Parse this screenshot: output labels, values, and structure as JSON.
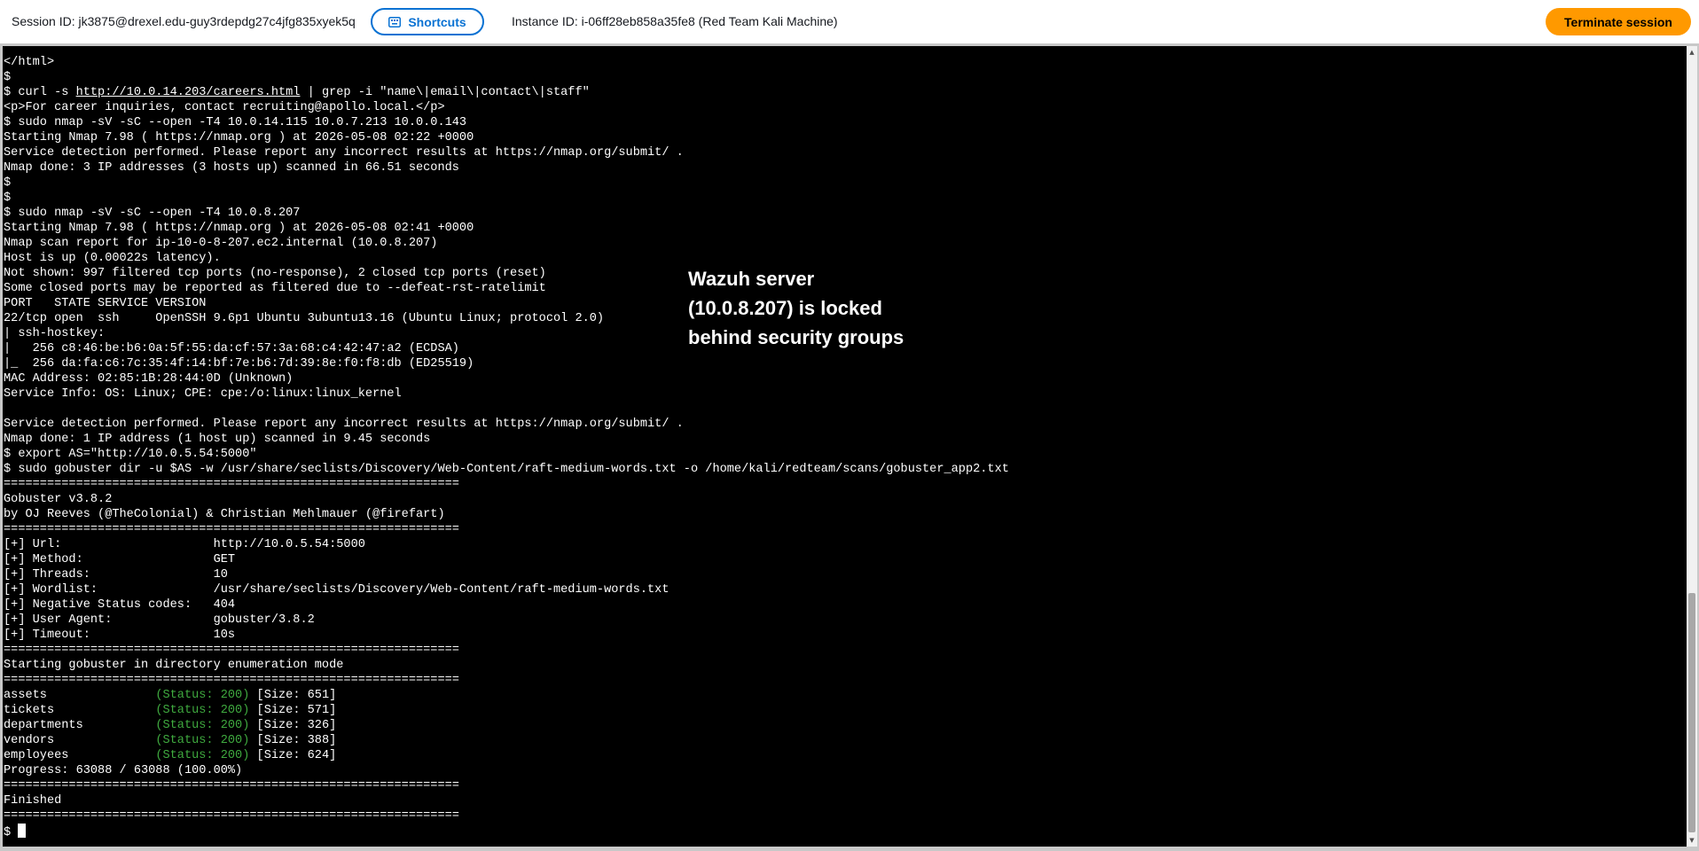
{
  "header": {
    "session_id": "Session ID: jk3875@drexel.edu-guy3rdepdg27c4jfg835xyek5q",
    "shortcuts_label": "Shortcuts",
    "instance_id": "Instance ID: i-06ff28eb858a35fe8 (Red Team Kali Machine)",
    "terminate_label": "Terminate session",
    "colors": {
      "shortcuts_border": "#0972d3",
      "terminate_bg": "#ff9900"
    }
  },
  "terminal": {
    "lines": [
      "</html>",
      "$",
      "$ curl -s http://10.0.14.203/careers.html | grep -i \"name\\|email\\|contact\\|staff\"",
      "<p>For career inquiries, contact recruiting@apollo.local.</p>",
      "$ sudo nmap -sV -sC --open -T4 10.0.14.115 10.0.7.213 10.0.0.143",
      "Starting Nmap 7.98 ( https://nmap.org ) at 2026-05-08 02:22 +0000",
      "Service detection performed. Please report any incorrect results at https://nmap.org/submit/ .",
      "Nmap done: 3 IP addresses (3 hosts up) scanned in 66.51 seconds",
      "$",
      "$",
      "$ sudo nmap -sV -sC --open -T4 10.0.8.207",
      "Starting Nmap 7.98 ( https://nmap.org ) at 2026-05-08 02:41 +0000",
      "Nmap scan report for ip-10-0-8-207.ec2.internal (10.0.8.207)",
      "Host is up (0.00022s latency).",
      "Not shown: 997 filtered tcp ports (no-response), 2 closed tcp ports (reset)",
      "Some closed ports may be reported as filtered due to --defeat-rst-ratelimit",
      "PORT   STATE SERVICE VERSION",
      "22/tcp open  ssh     OpenSSH 9.6p1 Ubuntu 3ubuntu13.16 (Ubuntu Linux; protocol 2.0)",
      "| ssh-hostkey:",
      "|   256 c8:46:be:b6:0a:5f:55:da:cf:57:3a:68:c4:42:47:a2 (ECDSA)",
      "|_  256 da:fa:c6:7c:35:4f:14:bf:7e:b6:7d:39:8e:f0:f8:db (ED25519)",
      "MAC Address: 02:85:1B:28:44:0D (Unknown)",
      "Service Info: OS: Linux; CPE: cpe:/o:linux:linux_kernel",
      "",
      "Service detection performed. Please report any incorrect results at https://nmap.org/submit/ .",
      "Nmap done: 1 IP address (1 host up) scanned in 9.45 seconds",
      "$ export AS=\"http://10.0.5.54:5000\"",
      "$ sudo gobuster dir -u $AS -w /usr/share/seclists/Discovery/Web-Content/raft-medium-words.txt -o /home/kali/redteam/scans/gobuster_app2.txt",
      "===============================================================",
      "Gobuster v3.8.2",
      "by OJ Reeves (@TheColonial) & Christian Mehlmauer (@firefart)",
      "===============================================================",
      "[+] Url:                     http://10.0.5.54:5000",
      "[+] Method:                  GET",
      "[+] Threads:                 10",
      "[+] Wordlist:                /usr/share/seclists/Discovery/Web-Content/raft-medium-words.txt",
      "[+] Negative Status codes:   404",
      "[+] User Agent:              gobuster/3.8.2",
      "[+] Timeout:                 10s",
      "===============================================================",
      "Starting gobuster in directory enumeration mode",
      "==============================================================="
    ],
    "results": [
      {
        "name": "assets               ",
        "status": "(Status: 200)",
        "size": " [Size: 651]"
      },
      {
        "name": "tickets              ",
        "status": "(Status: 200)",
        "size": " [Size: 571]"
      },
      {
        "name": "departments          ",
        "status": "(Status: 200)",
        "size": " [Size: 326]"
      },
      {
        "name": "vendors              ",
        "status": "(Status: 200)",
        "size": " [Size: 388]"
      },
      {
        "name": "employees            ",
        "status": "(Status: 200)",
        "size": " [Size: 624]"
      }
    ],
    "tail_lines": [
      "Progress: 63088 / 63088 (100.00%)",
      "===============================================================",
      "Finished",
      "==============================================================="
    ],
    "prompt": "$",
    "colors": {
      "background": "#000000",
      "text": "#ffffff",
      "status": "#3faa3f"
    }
  },
  "annotation": {
    "text": "Wazuh server\n(10.0.8.207) is locked\nbehind security groups"
  }
}
